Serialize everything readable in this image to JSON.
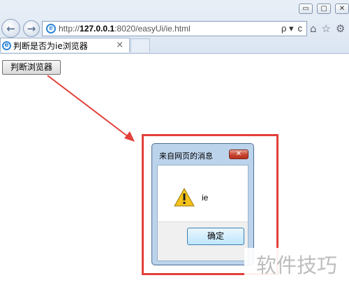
{
  "browser": {
    "window_controls": {
      "minimize": "▭",
      "maximize": "▢",
      "close": "✕"
    },
    "nav": {
      "back_icon": "back-arrow-icon",
      "forward_icon": "forward-arrow-icon"
    },
    "address": {
      "protocol": "http://",
      "host": "127.0.0.1",
      "path": ":8020/easyUi/ie.html"
    },
    "address_actions": {
      "search": "ρ ▾",
      "refresh": "ᴄ"
    },
    "toolbar_icons": [
      "home-icon",
      "star-icon",
      "gear-icon"
    ],
    "tab": {
      "title": "判断是否为ie浏览器",
      "close": "×"
    }
  },
  "page": {
    "detect_button_label": "判断浏览器"
  },
  "dialog": {
    "title": "来自网页的消息",
    "close_label": "✕",
    "message": "ie",
    "ok_label": "确定"
  },
  "watermark": "软件技巧",
  "colors": {
    "annotation_red": "#e2403a",
    "ie_blue": "#2f86d8",
    "warning_yellow": "#f4c21b"
  }
}
